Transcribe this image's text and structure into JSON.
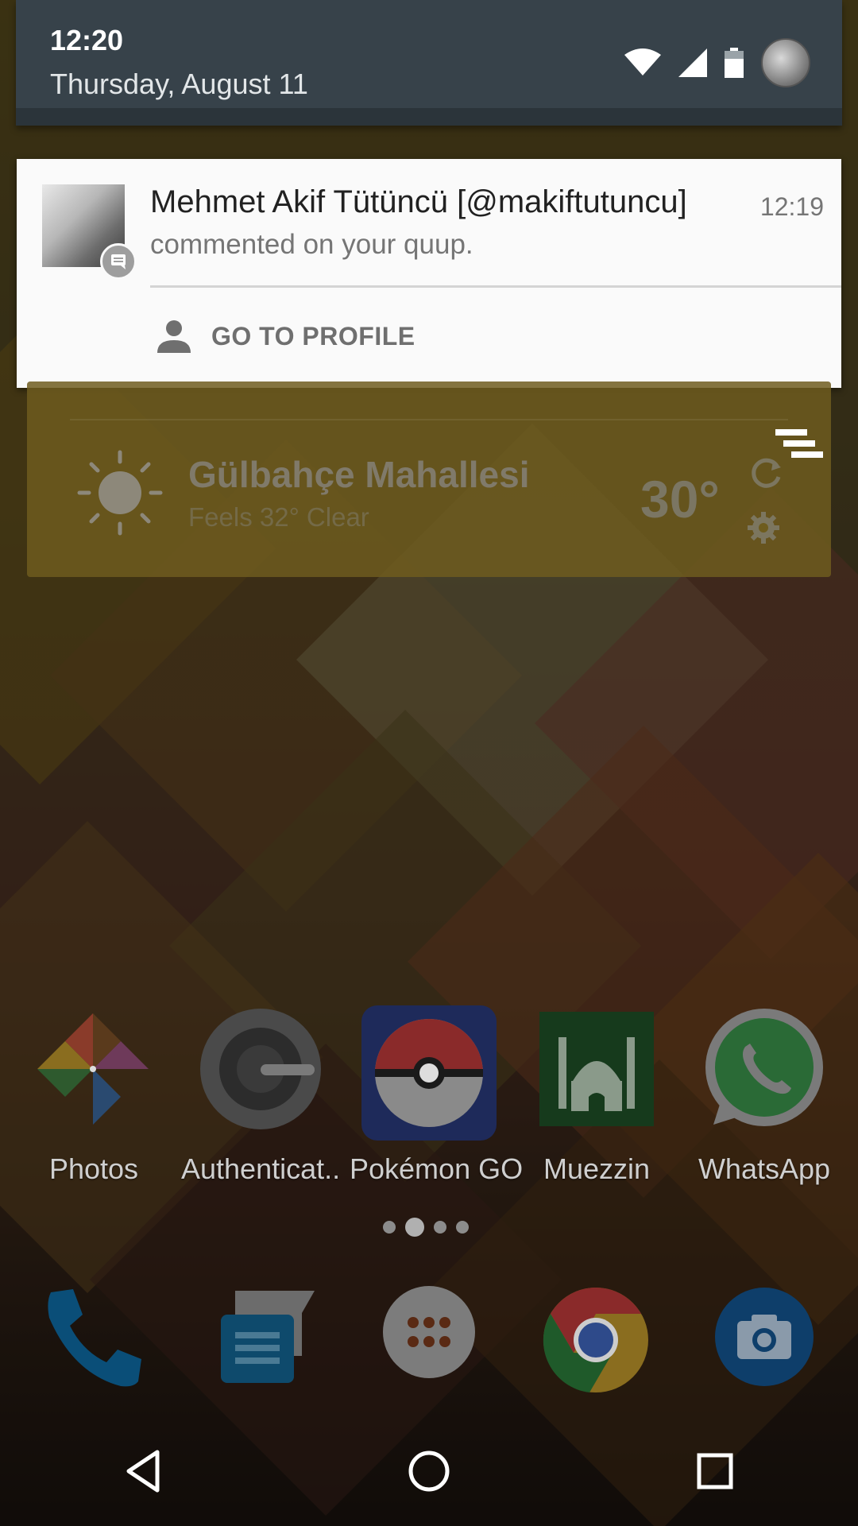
{
  "status": {
    "time": "12:20",
    "date": "Thursday, August 11"
  },
  "notification": {
    "title": "Mehmet Akif Tütüncü [@makiftutuncu]",
    "time": "12:19",
    "text": "commented on your quup.",
    "action_label": "GO TO PROFILE"
  },
  "weather": {
    "location": "Gülbahçe Mahallesi",
    "subtitle": "Feels 32° Clear",
    "temperature": "30°"
  },
  "apps": [
    {
      "label": "Photos",
      "icon": "photos-icon"
    },
    {
      "label": "Authenticat..",
      "icon": "authenticator-icon"
    },
    {
      "label": "Pokémon GO",
      "icon": "pokemon-go-icon"
    },
    {
      "label": "Muezzin",
      "icon": "muezzin-icon"
    },
    {
      "label": "WhatsApp",
      "icon": "whatsapp-icon"
    }
  ],
  "dock": [
    {
      "icon": "phone-icon"
    },
    {
      "icon": "messages-icon"
    },
    {
      "icon": "app-drawer-icon"
    },
    {
      "icon": "chrome-icon"
    },
    {
      "icon": "camera-icon"
    }
  ],
  "page_indicator": {
    "pages": 4,
    "current": 2
  },
  "colors": {
    "shade": "#37424a",
    "notification_bg": "#fafafa",
    "weather_bg": "#6e5c1e"
  }
}
